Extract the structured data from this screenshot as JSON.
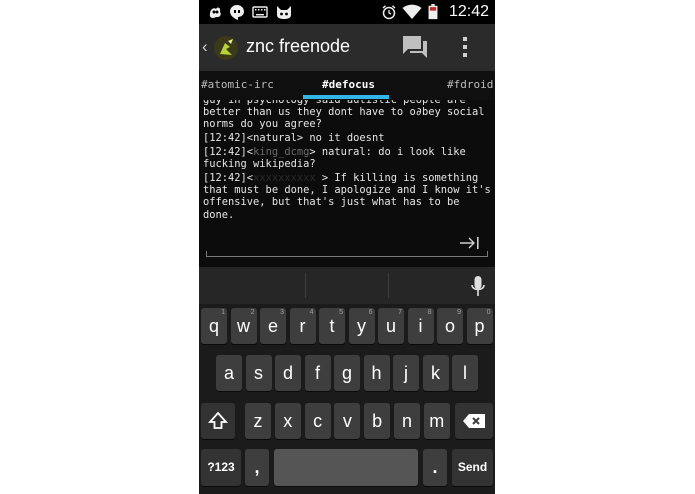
{
  "status_bar": {
    "time": "12:42",
    "icons_left": [
      "blob-icon",
      "hangouts-icon",
      "keyboard-icon",
      "cat-icon"
    ],
    "icons_right": [
      "alarm-icon",
      "wifi-icon",
      "battery-icon"
    ]
  },
  "action_bar": {
    "title": "znc freenode"
  },
  "tabs": {
    "items": [
      "#atomic-irc",
      "#defocus",
      "#fdroid"
    ],
    "active_index": 1,
    "accent": "#33b5e5"
  },
  "chat": {
    "messages": [
      {
        "ts": "",
        "nick": "",
        "text": "guy in psychology said autistic people are better than us they dont have to o∂bey social norms do you agree?"
      },
      {
        "ts": "[12:42]",
        "nick": "natural",
        "text": " no it doesnt"
      },
      {
        "ts": "[12:42]",
        "nick": "king_dcmg",
        "text": " natural: do i look like fucking wikipedia?"
      },
      {
        "ts": "[12:42]",
        "nick": "",
        "text": " > If killing is something that must be done, I apologize and I know it's offensive, but that's just what has to be done."
      }
    ]
  },
  "keyboard": {
    "row1": [
      {
        "k": "q",
        "h": "1"
      },
      {
        "k": "w",
        "h": "2"
      },
      {
        "k": "e",
        "h": "3"
      },
      {
        "k": "r",
        "h": "4"
      },
      {
        "k": "t",
        "h": "5"
      },
      {
        "k": "y",
        "h": "6"
      },
      {
        "k": "u",
        "h": "7"
      },
      {
        "k": "i",
        "h": "8"
      },
      {
        "k": "o",
        "h": "9"
      },
      {
        "k": "p",
        "h": "0"
      }
    ],
    "row2": [
      "a",
      "s",
      "d",
      "f",
      "g",
      "h",
      "j",
      "k",
      "l"
    ],
    "row3": [
      "z",
      "x",
      "c",
      "v",
      "b",
      "n",
      "m"
    ],
    "symbols_label": "?123",
    "comma_label": ",",
    "period_label": ".",
    "send_label": "Send"
  }
}
